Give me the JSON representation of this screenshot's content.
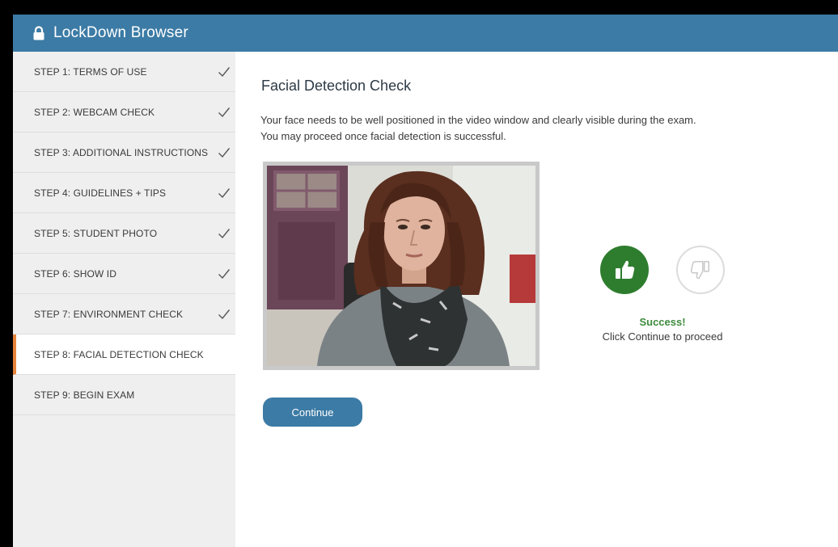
{
  "window": {
    "title": "LockDown Browser"
  },
  "sidebar": {
    "steps": [
      {
        "label": "STEP 1: TERMS OF USE"
      },
      {
        "label": "STEP 2: WEBCAM CHECK"
      },
      {
        "label": "STEP 3: ADDITIONAL INSTRUCTIONS"
      },
      {
        "label": "STEP 4: GUIDELINES + TIPS"
      },
      {
        "label": "STEP 5: STUDENT PHOTO"
      },
      {
        "label": "STEP 6: SHOW ID"
      },
      {
        "label": "STEP 7: ENVIRONMENT CHECK"
      },
      {
        "label": "STEP 8: FACIAL DETECTION CHECK"
      },
      {
        "label": "STEP 9: BEGIN EXAM"
      }
    ]
  },
  "main": {
    "heading": "Facial Detection Check",
    "description_line1": "Your face needs to be well positioned in the video window and clearly visible during the exam.",
    "description_line2": "You may proceed once facial detection is successful.",
    "status_title": "Success!",
    "status_message": "Click Continue to proceed",
    "continue_label": "Continue"
  },
  "colors": {
    "brand": "#3c7ba5",
    "active_step_accent": "#e6833a",
    "success": "#2e7d2e",
    "sidebar_bg": "#efefef"
  },
  "icons": {
    "title": "lock-icon",
    "step_complete": "checkmark-icon",
    "approve": "thumbs-up-icon",
    "reject": "thumbs-down-icon"
  }
}
